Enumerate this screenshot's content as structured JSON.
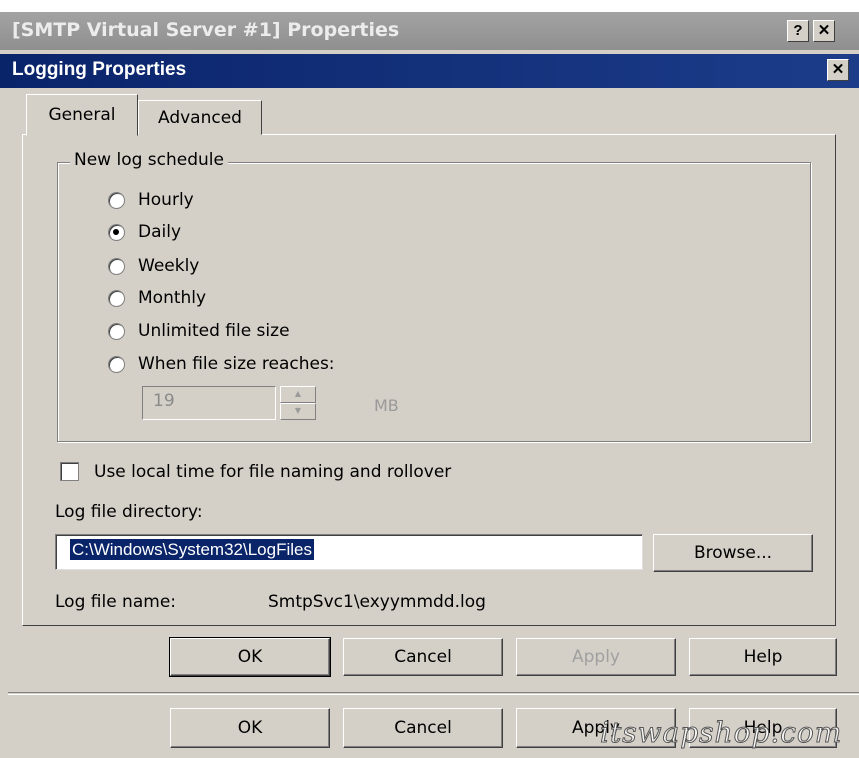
{
  "parent_window": {
    "title": "[SMTP Virtual Server #1] Properties",
    "help_button": "?",
    "close_button": "✕",
    "buttons": {
      "ok": "OK",
      "cancel": "Cancel",
      "apply": "Apply",
      "help": "Help"
    }
  },
  "dialog": {
    "title": "Logging Properties",
    "close_button": "✕",
    "tabs": [
      {
        "label": "General",
        "active": true
      },
      {
        "label": "Advanced",
        "active": false
      }
    ],
    "schedule_group": {
      "legend": "New log schedule",
      "options": [
        {
          "label": "Hourly",
          "selected": false
        },
        {
          "label": "Daily",
          "selected": true
        },
        {
          "label": "Weekly",
          "selected": false
        },
        {
          "label": "Monthly",
          "selected": false
        },
        {
          "label": "Unlimited file size",
          "selected": false
        },
        {
          "label": "When file size reaches:",
          "selected": false
        }
      ],
      "size_value": "19",
      "size_unit": "MB"
    },
    "local_time_label": "Use local time for file naming and rollover",
    "local_time_checked": false,
    "log_dir_label": "Log file directory:",
    "log_dir_value": "C:\\Windows\\System32\\LogFiles",
    "browse_button": "Browse...",
    "log_name_label": "Log file name:",
    "log_name_value": "SmtpSvc1\\exyymmdd.log",
    "buttons": {
      "ok": "OK",
      "cancel": "Cancel",
      "apply": "Apply",
      "help": "Help"
    }
  },
  "watermark": "itswapshop.com"
}
